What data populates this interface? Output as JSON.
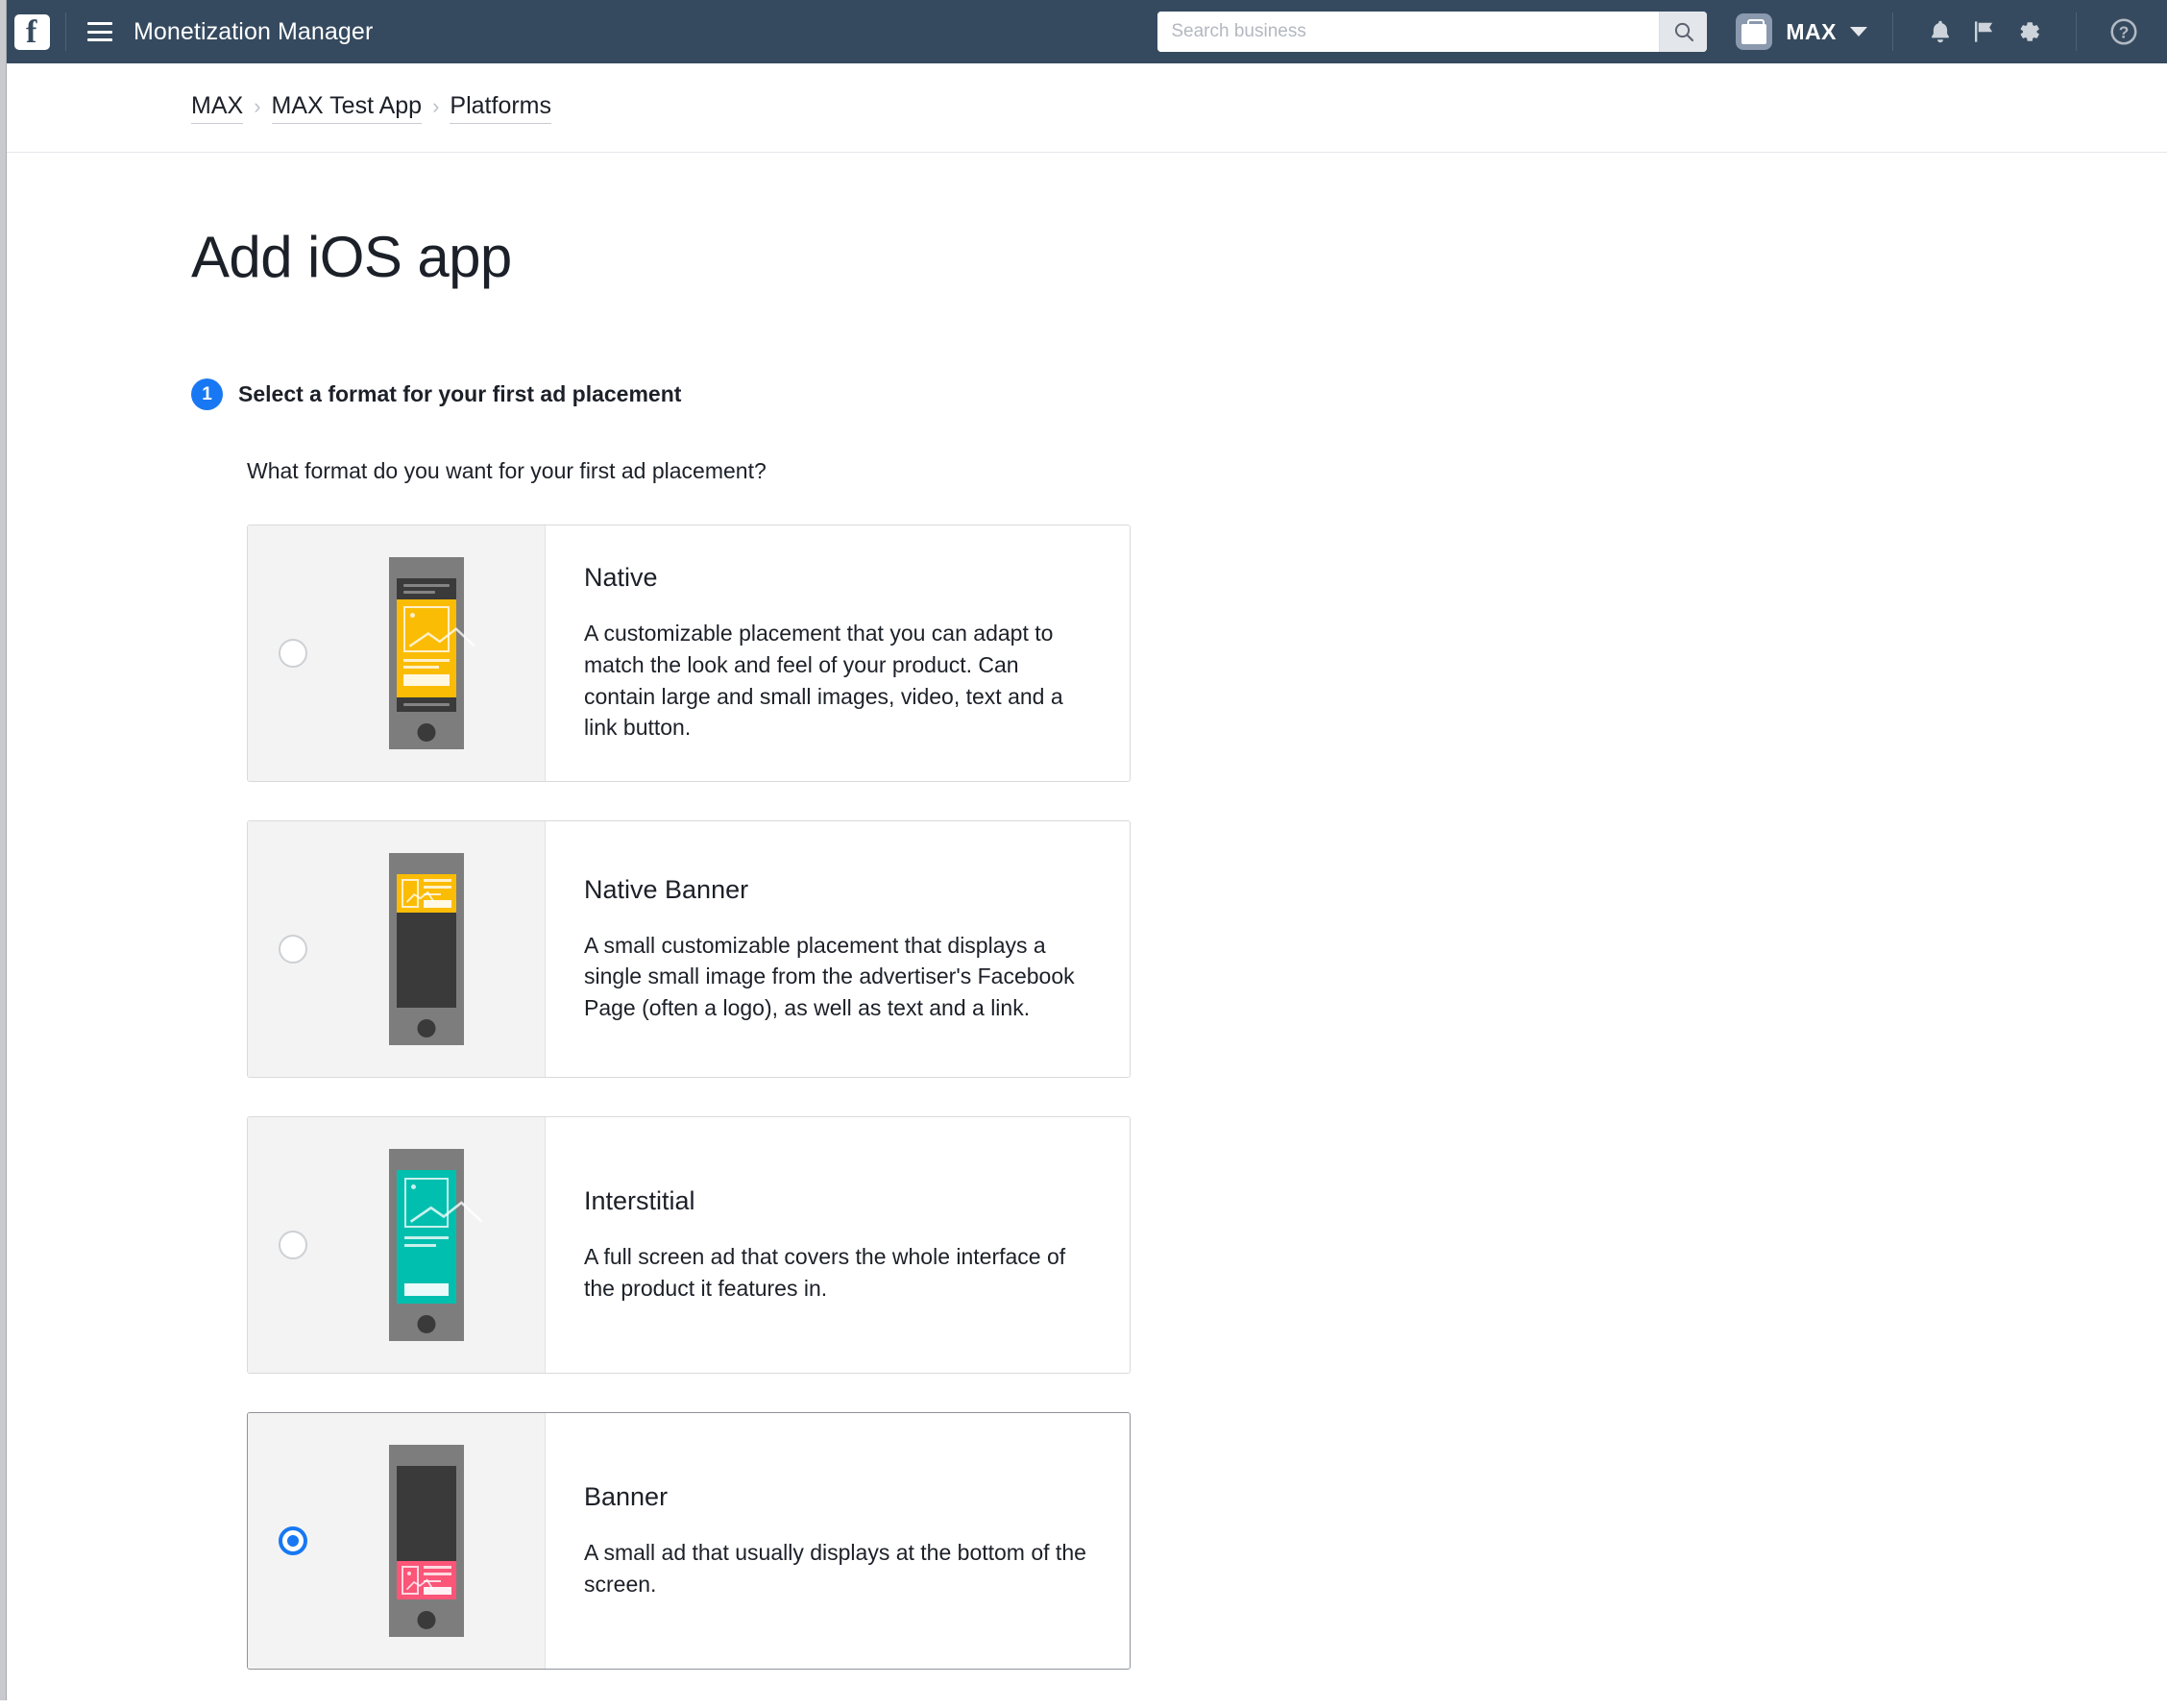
{
  "topbar": {
    "logo_alt": "Facebook",
    "app_title": "Monetization Manager",
    "search_placeholder": "Search business",
    "search_value": "",
    "business_name": "MAX"
  },
  "breadcrumb": {
    "items": [
      "MAX",
      "MAX Test App",
      "Platforms"
    ],
    "separator": "›"
  },
  "page": {
    "title": "Add iOS app",
    "step_number": "1",
    "step_title": "Select a format for your first ad placement",
    "question": "What format do you want for your first ad placement?"
  },
  "formats": [
    {
      "id": "native",
      "name": "Native",
      "description": "A customizable placement that you can adapt to match the look and feel of your product. Can contain large and small images, video, text and a link button.",
      "selected": false,
      "accent": "#fbbc05",
      "preview": "native"
    },
    {
      "id": "native-banner",
      "name": "Native Banner",
      "description": "A small customizable placement that displays a single small image from the advertiser's Facebook Page (often a logo), as well as text and a link.",
      "selected": false,
      "accent": "#fbbc05",
      "preview": "native-banner"
    },
    {
      "id": "interstitial",
      "name": "Interstitial",
      "description": "A full screen ad that covers the whole interface of the product it features in.",
      "selected": false,
      "accent": "#00bfae",
      "preview": "interstitial"
    },
    {
      "id": "banner",
      "name": "Banner",
      "description": "A small ad that usually displays at the bottom of the screen.",
      "selected": true,
      "accent": "#fb5578",
      "preview": "banner"
    }
  ],
  "colors": {
    "topbar_bg": "#354a5f",
    "accent_blue": "#1878f3",
    "card_left_bg": "#f3f3f3",
    "phone_body": "#7d7d7d",
    "phone_dark": "#3a3a3a"
  },
  "icons": {
    "hamburger": "hamburger-icon",
    "search": "search-icon",
    "bell": "bell-icon",
    "flag": "flag-icon",
    "gear": "gear-icon",
    "help": "help-icon",
    "caret": "chevron-down-icon"
  }
}
